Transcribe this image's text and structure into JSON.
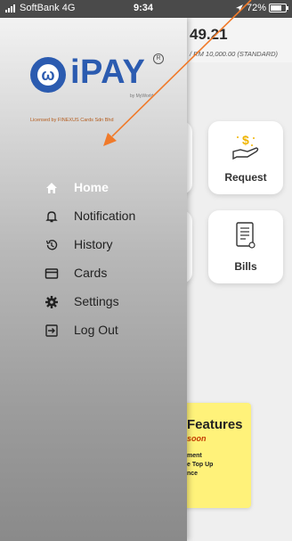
{
  "status_bar": {
    "carrier": "SoftBank 4G",
    "time": "9:34",
    "battery": "72%",
    "battery_level": 0.72
  },
  "account": {
    "balance_partial": "49.21",
    "limit_partial": "/ RM 10,000.00 (STANDARD)"
  },
  "tiles": {
    "request_label": "Request",
    "bills_label": "Bills"
  },
  "feature_card": {
    "title": "Features",
    "subtitle": "soon",
    "lines": [
      "ment",
      "e Top Up",
      "nce"
    ]
  },
  "drawer": {
    "brand": "iPAY",
    "brand_by": "by MyWorld",
    "licensed": "Licensed by FINEXUS Cards Sdn Bhd",
    "menu": [
      {
        "label": "Home",
        "icon": "home-icon",
        "active": true
      },
      {
        "label": "Notification",
        "icon": "bell-icon",
        "active": false
      },
      {
        "label": "History",
        "icon": "history-icon",
        "active": false
      },
      {
        "label": "Cards",
        "icon": "card-icon",
        "active": false
      },
      {
        "label": "Settings",
        "icon": "gear-icon",
        "active": false
      },
      {
        "label": "Log Out",
        "icon": "logout-icon",
        "active": false
      }
    ]
  },
  "colors": {
    "brand_blue": "#2b5bb0",
    "annotation_arrow": "#f07a2a",
    "feature_yellow": "#fff27a"
  }
}
